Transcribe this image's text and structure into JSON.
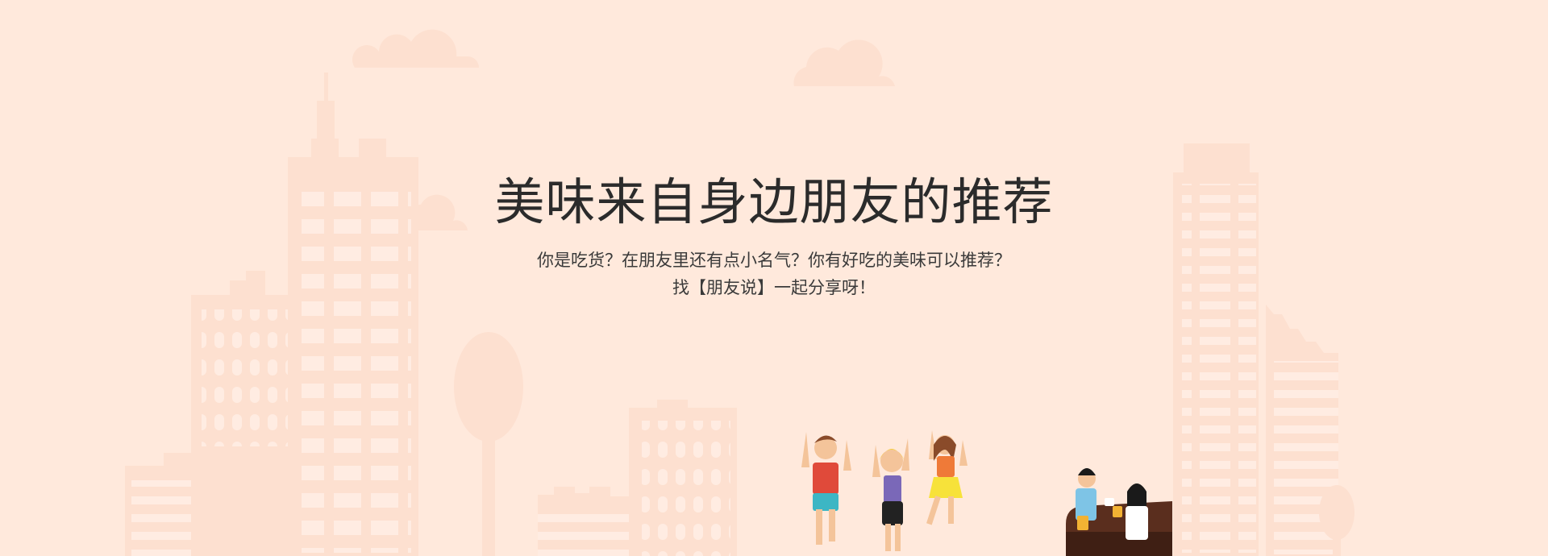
{
  "hero": {
    "title": "美味来自身边朋友的推荐",
    "subtitle_line1": "你是吃货？在朋友里还有点小名气？你有好吃的美味可以推荐？",
    "subtitle_line2": "找【朋友说】一起分享呀！"
  },
  "colors": {
    "background": "#ffe9dc",
    "building": "#fde0d0",
    "window": "#ffece2",
    "text": "#2b2b2b"
  },
  "icons": [
    "cityscape-illustration",
    "cloud-icon",
    "tree-icon",
    "dancing-friends-illustration",
    "bar-friends-illustration"
  ]
}
